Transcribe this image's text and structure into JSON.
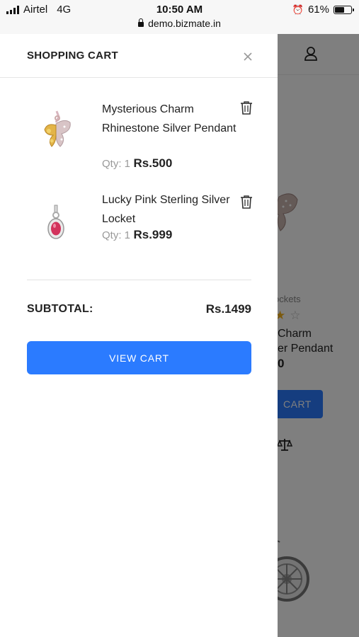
{
  "status_bar": {
    "carrier": "Airtel",
    "network": "4G",
    "time": "10:50 AM",
    "url": "demo.bizmate.in",
    "battery_percent": "61%",
    "battery_level": 0.61
  },
  "background_page": {
    "category": "ockets",
    "product_title_line1": "Charm",
    "product_title_line2": "er Pendant",
    "price_fragment": "0",
    "button_fragment": "CART"
  },
  "cart": {
    "title": "SHOPPING CART",
    "items": [
      {
        "name": "Mysterious Charm Rhinestone Silver Pendant",
        "qty_label": "Qty: 1",
        "price": "Rs.500",
        "image": "butterfly-pendant"
      },
      {
        "name": "Lucky Pink Sterling Silver Locket",
        "qty_label": "Qty: 1",
        "price": "Rs.999",
        "image": "pink-locket"
      }
    ],
    "subtotal_label": "SUBTOTAL:",
    "subtotal_value": "Rs.1499",
    "view_cart_label": "VIEW CART"
  },
  "colors": {
    "accent": "#2b7bff",
    "overlay": "rgba(0,0,0,0.5)"
  },
  "icons": [
    "signal-icon",
    "lock-icon",
    "alarm-icon",
    "battery-icon",
    "user-icon",
    "close-icon",
    "trash-icon",
    "compare-icon",
    "star-icon"
  ]
}
